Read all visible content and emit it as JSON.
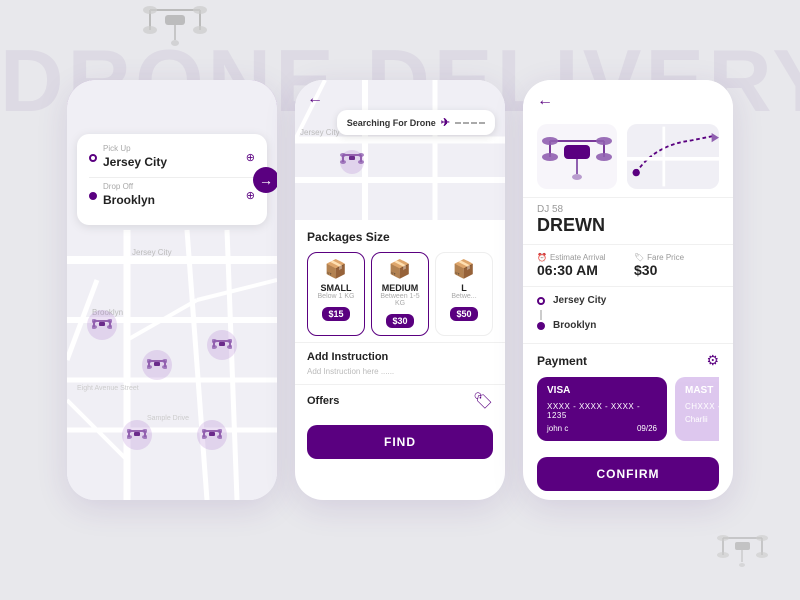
{
  "background": {
    "title": "DRONE DELIVERY"
  },
  "phone1": {
    "pickup_label": "Pick Up",
    "pickup_city": "Jersey City",
    "dropoff_label": "Drop Off",
    "dropoff_city": "Brooklyn"
  },
  "phone2": {
    "searching_text": "Searching For Drone",
    "packages_title": "Packages Size",
    "packages": [
      {
        "name": "SMALL",
        "desc": "Below 1 KG",
        "price": "$15"
      },
      {
        "name": "MEDIUM",
        "desc": "Between 1-5 KG",
        "price": "$30"
      },
      {
        "name": "LARGE",
        "desc": "Betwe...",
        "price": "$50"
      }
    ],
    "add_instruction_title": "Add Instruction",
    "add_instruction_placeholder": "Add Instruction here ......",
    "offers_title": "Offers",
    "find_btn": "FIND"
  },
  "phone3": {
    "drone_id": "DJ 58",
    "drone_name": "DREWN",
    "arrival_label": "Estimate Arrival",
    "arrival_value": "06:30 AM",
    "fare_label": "Fare Price",
    "fare_value": "$30",
    "from_city": "Jersey City",
    "to_city": "Brooklyn",
    "payment_title": "Payment",
    "cards": [
      {
        "brand": "VISA",
        "number": "XXXX - XXXX - XXXX - 1235",
        "holder": "john c",
        "expiry": "09/26"
      },
      {
        "brand": "MAST",
        "number": "CHXXX -",
        "holder": "Charlii",
        "expiry": ""
      }
    ],
    "confirm_btn": "CONFIRM"
  }
}
